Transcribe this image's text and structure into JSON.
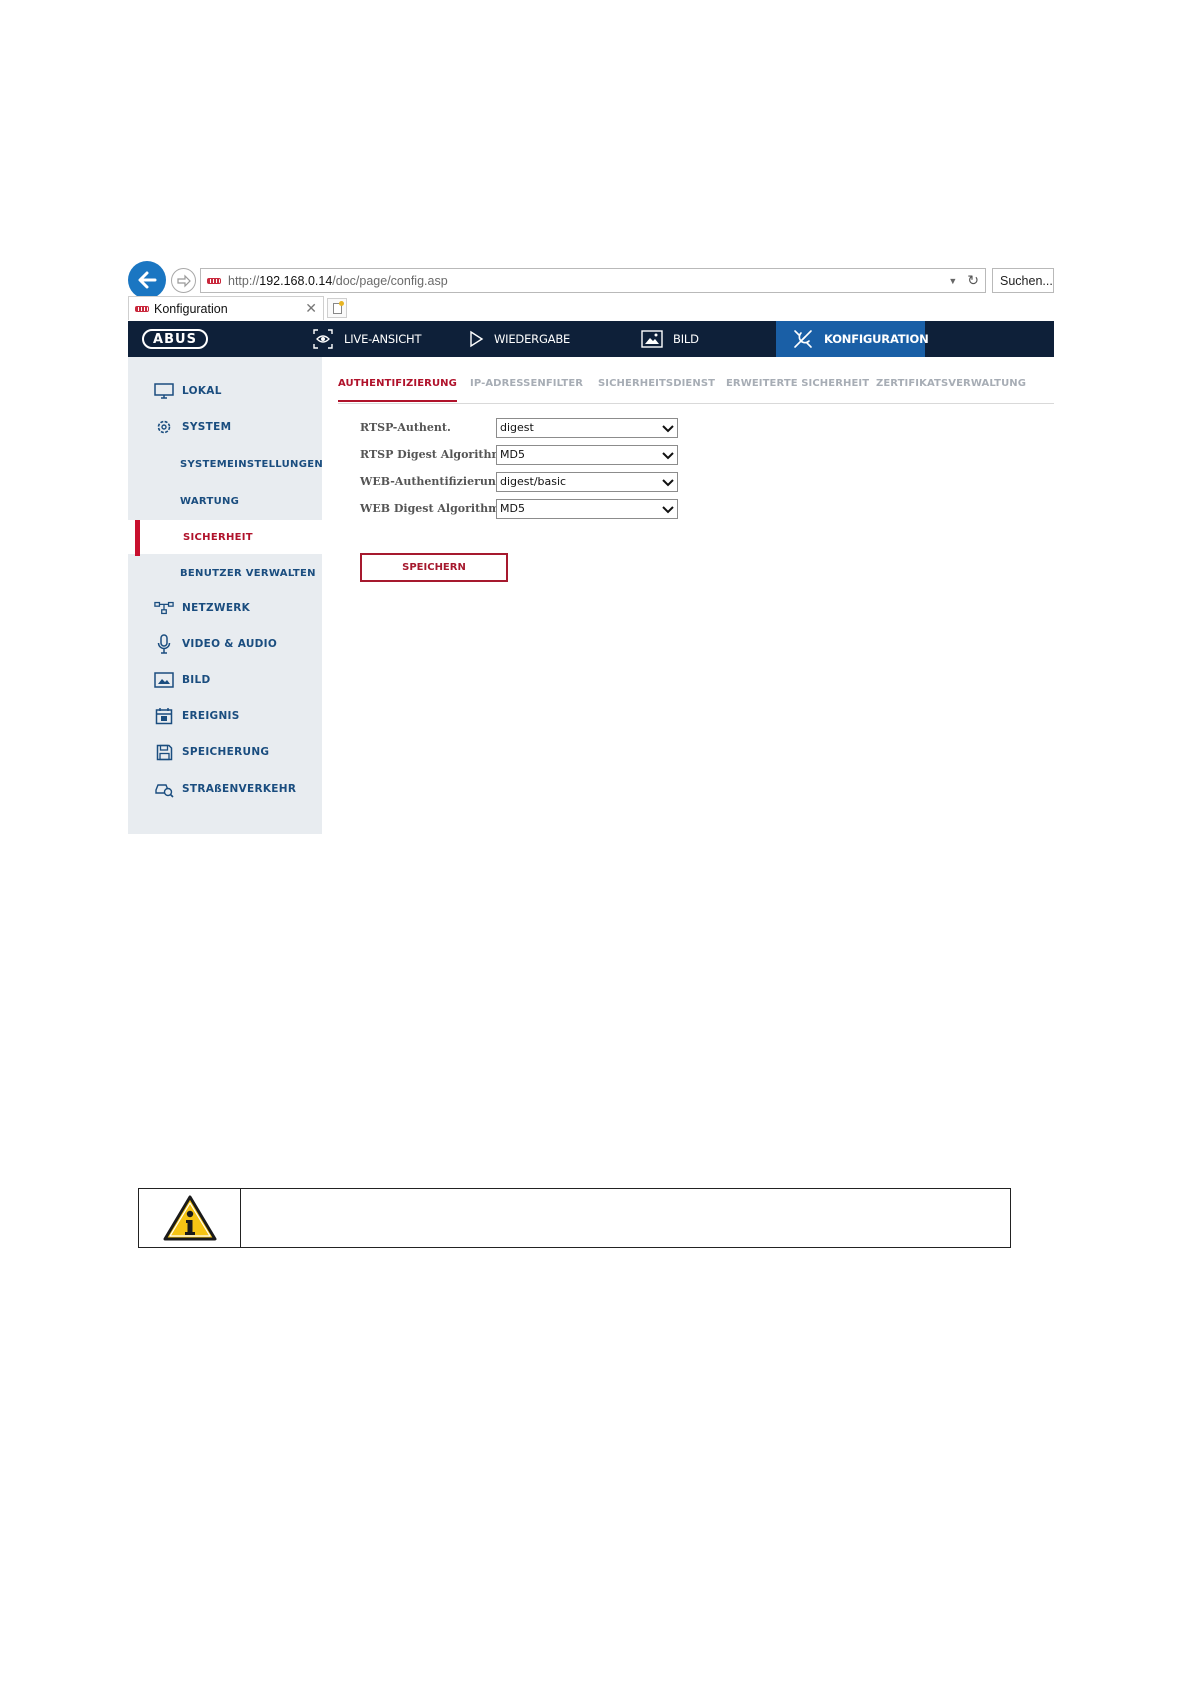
{
  "browser": {
    "url_prefix": "http://",
    "url_host": "192.168.0.14",
    "url_path": "/doc/page/config.asp",
    "search_placeholder": "Suchen...",
    "tab_title": "Konfiguration"
  },
  "topnav": {
    "logo": "ABUS",
    "items": [
      {
        "label": "LIVE-ANSICHT",
        "icon": "eye-icon"
      },
      {
        "label": "WIEDERGABE",
        "icon": "play-icon"
      },
      {
        "label": "BILD",
        "icon": "image-icon"
      },
      {
        "label": "KONFIGURATION",
        "icon": "tools-icon",
        "active": true
      }
    ]
  },
  "sidebar": {
    "items": [
      {
        "label": "LOKAL",
        "icon": "monitor-icon"
      },
      {
        "label": "SYSTEM",
        "icon": "gear-icon"
      },
      {
        "label": "SYSTEMEINSTELLUNGEN",
        "sub": true
      },
      {
        "label": "WARTUNG",
        "sub": true
      },
      {
        "label": "SICHERHEIT",
        "sub": true,
        "active": true
      },
      {
        "label": "BENUTZER VERWALTEN",
        "sub": true
      },
      {
        "label": "NETZWERK",
        "icon": "network-icon"
      },
      {
        "label": "VIDEO & AUDIO",
        "icon": "microphone-icon"
      },
      {
        "label": "BILD",
        "icon": "image-icon"
      },
      {
        "label": "EREIGNIS",
        "icon": "calendar-icon"
      },
      {
        "label": "SPEICHERUNG",
        "icon": "floppy-icon"
      },
      {
        "label": "STRAßENVERKEHR",
        "icon": "car-search-icon"
      }
    ]
  },
  "subtabs": [
    {
      "label": "AUTHENTIFIZIERUNG",
      "active": true
    },
    {
      "label": "IP-ADRESSENFILTER"
    },
    {
      "label": "SICHERHEITSDIENST"
    },
    {
      "label": "ERWEITERTE SICHERHEIT"
    },
    {
      "label": "ZERTIFIKATSVERWALTUNG"
    }
  ],
  "form": {
    "rows": [
      {
        "label": "RTSP-Authent.",
        "value": "digest"
      },
      {
        "label": "RTSP Digest Algorithm",
        "value": "MD5"
      },
      {
        "label": "WEB-Authentifizierung",
        "value": "digest/basic"
      },
      {
        "label": "WEB Digest Algorithm",
        "value": "MD5"
      }
    ],
    "save_label": "SPEICHERN"
  },
  "colors": {
    "nav_bg": "#0e2039",
    "nav_active": "#1a5fa6",
    "accent_red": "#b0122b",
    "sidebar_bg": "#e8ecf0",
    "sidebar_text": "#1a4d7f"
  }
}
